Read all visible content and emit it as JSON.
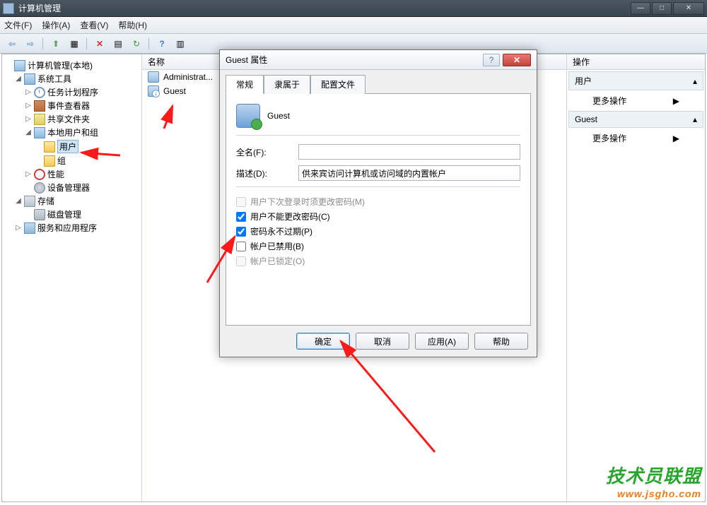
{
  "window": {
    "title": "计算机管理"
  },
  "menubar": [
    "文件(F)",
    "操作(A)",
    "查看(V)",
    "帮助(H)"
  ],
  "tree": {
    "root": "计算机管理(本地)",
    "sys_tools": "系统工具",
    "task_sched": "任务计划程序",
    "event_viewer": "事件查看器",
    "shared_folders": "共享文件夹",
    "local_users_groups": "本地用户和组",
    "users": "用户",
    "groups": "组",
    "performance": "性能",
    "device_mgr": "设备管理器",
    "storage": "存储",
    "disk_mgmt": "磁盘管理",
    "services_apps": "服务和应用程序"
  },
  "center": {
    "header": "名称",
    "rows": [
      "Administrat...",
      "Guest"
    ]
  },
  "actions": {
    "header": "操作",
    "group1": "用户",
    "more": "更多操作",
    "group2": "Guest"
  },
  "dialog": {
    "title": "Guest 属性",
    "tabs": [
      "常规",
      "隶属于",
      "配置文件"
    ],
    "username": "Guest",
    "fullname_label": "全名(F):",
    "fullname_value": "",
    "desc_label": "描述(D):",
    "desc_value": "供来宾访问计算机或访问域的内置帐户",
    "chk_must_change": "用户下次登录时须更改密码(M)",
    "chk_cannot_change": "用户不能更改密码(C)",
    "chk_never_expires": "密码永不过期(P)",
    "chk_disabled": "帐户已禁用(B)",
    "chk_locked": "帐户已锁定(O)",
    "btn_ok": "确定",
    "btn_cancel": "取消",
    "btn_apply": "应用(A)",
    "btn_help": "帮助"
  },
  "watermark": {
    "line1": "技术员联盟",
    "line2": "www.jsgho.com"
  }
}
